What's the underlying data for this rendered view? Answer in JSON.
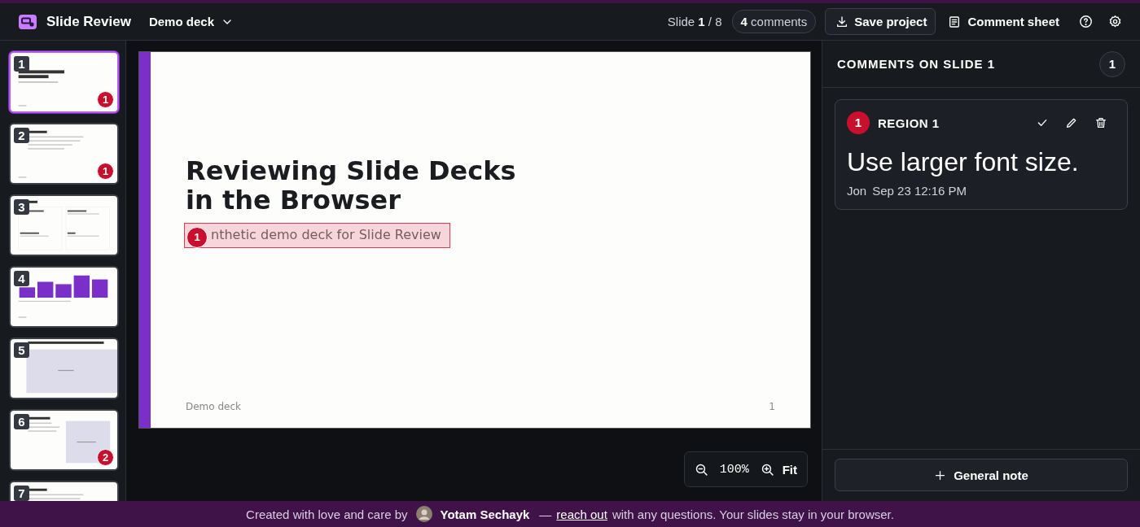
{
  "app": {
    "title": "Slide Review",
    "deck_name": "Demo deck"
  },
  "header": {
    "slide_label": "Slide",
    "slide_current": "1",
    "slide_total": "/ 8",
    "comments_count": "4",
    "comments_label": "comments",
    "save_button": "Save project",
    "sheet_button": "Comment sheet"
  },
  "thumbnails": [
    {
      "number": "1",
      "selected": true,
      "kind": "title",
      "comments": "1"
    },
    {
      "number": "2",
      "selected": false,
      "kind": "bullets",
      "comments": "1"
    },
    {
      "number": "3",
      "selected": false,
      "kind": "grid"
    },
    {
      "number": "4",
      "selected": false,
      "kind": "chart"
    },
    {
      "number": "5",
      "selected": false,
      "kind": "figure"
    },
    {
      "number": "6",
      "selected": false,
      "kind": "split",
      "comments": "2"
    },
    {
      "number": "7",
      "selected": false,
      "kind": "bullets"
    }
  ],
  "slide": {
    "title": "Reviewing Slide Decks in the Browser",
    "subtitle": "nthetic demo deck for Slide Review",
    "region_number": "1",
    "footer_left": "Demo deck",
    "page_number": "1"
  },
  "zoom": {
    "value": "100%",
    "fit": "Fit"
  },
  "comments_panel": {
    "heading": "COMMENTS ON SLIDE 1",
    "count": "1",
    "comments": [
      {
        "number": "1",
        "region": "REGION 1",
        "text": "Use larger font size.",
        "author": "Jon",
        "time": "Sep 23 12:16 PM"
      }
    ],
    "general_note": "General note"
  },
  "footer": {
    "prefix": "Created with love and care by",
    "author": "Yotam Sechayk",
    "dash": "—",
    "link": "reach out",
    "suffix": "with any questions. Your slides stay in your browser."
  }
}
